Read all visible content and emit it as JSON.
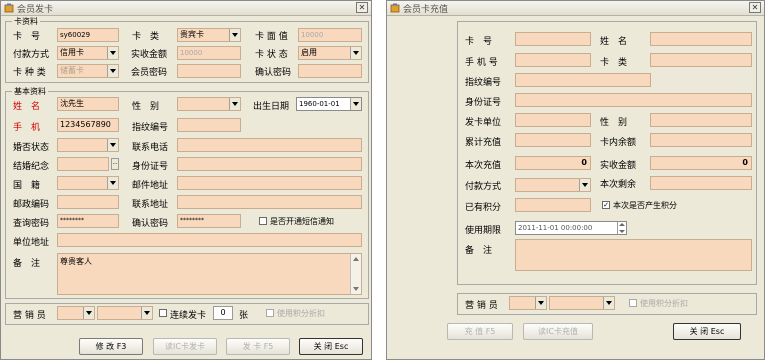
{
  "colors": {
    "field": "#f9d9bd",
    "window": "#ece9d8",
    "required_label": "#d40000"
  },
  "win1": {
    "title": "会员发卡",
    "card_group": {
      "title": "卡资料",
      "card_no_label": "卡　号",
      "card_no_value": "sy60029",
      "card_type_label": "卡　类",
      "card_type_value": "贵宾卡",
      "face_value_label": "卡 面 值",
      "face_value_value": "10000",
      "pay_method_label": "付款方式",
      "pay_method_value": "信用卡",
      "paid_amount_label": "实收金额",
      "paid_amount_value": "10000",
      "card_status_label": "卡 状 态",
      "card_status_value": "启用",
      "card_kind_label": "卡 种 类",
      "card_kind_value": "储蓄卡",
      "member_pwd_label": "会员密码",
      "confirm_pwd_label": "确认密码"
    },
    "basic_group": {
      "title": "基本资料",
      "name_label": "姓　名",
      "name_value": "沈先生",
      "gender_label": "性　别",
      "birth_label": "出生日期",
      "birth_value": "1960-01-01",
      "mobile_label": "手　机",
      "mobile_value": "1234567890",
      "fingerprint_label": "指纹编号",
      "marital_label": "婚否状态",
      "contact_phone_label": "联系电话",
      "anniversary_label": "结婚纪念",
      "idcard_label": "身份证号",
      "country_label": "国　籍",
      "email_label": "邮件地址",
      "postcode_label": "邮政编码",
      "contact_addr_label": "联系地址",
      "query_pwd_label": "查询密码",
      "query_pwd_value": "********",
      "confirm_pwd2_label": "确认密码",
      "confirm_pwd2_value": "********",
      "open_notify_label": "是否开通短信通知",
      "company_addr_label": "单位地址",
      "remark_label": "备　注",
      "remark_value": "尊贵客人"
    },
    "sales_label": "营 销 员",
    "continuous_label": "连续发卡",
    "count_value": "0",
    "count_unit": "张",
    "use_points_label": "使用积分折扣",
    "buttons": {
      "modify": "修 改 F3",
      "read_card": "读IC卡发卡",
      "issue": "发 卡 F5",
      "close": "关 闭 Esc"
    }
  },
  "win2": {
    "title": "会员卡充值",
    "card_no_label": "卡　号",
    "name_label": "姓　名",
    "mobile_label": "手 机 号",
    "card_type_label": "卡　类",
    "fingerprint_label": "指纹编号",
    "idcard_label": "身份证号",
    "issue_unit_label": "发卡单位",
    "gender_label": "性　别",
    "total_recharge_label": "累计充值",
    "balance_label": "卡内余额",
    "this_recharge_label": "本次充值",
    "this_recharge_value": "0",
    "paid_amount_label": "实收金额",
    "paid_amount_value": "0",
    "pay_method_label": "付款方式",
    "remaining_label": "本次剩余",
    "points_label": "已有积分",
    "gen_points_label": "本次是否产生积分",
    "expiry_label": "使用期限",
    "expiry_value": "2011-11-01 00:00:00",
    "remark_label": "备　注",
    "sales_label": "营 销 员",
    "use_points_label": "使用积分折扣",
    "buttons": {
      "recharge": "充 值 F5",
      "read_card": "读IC卡充值",
      "close": "关 闭 Esc"
    }
  }
}
